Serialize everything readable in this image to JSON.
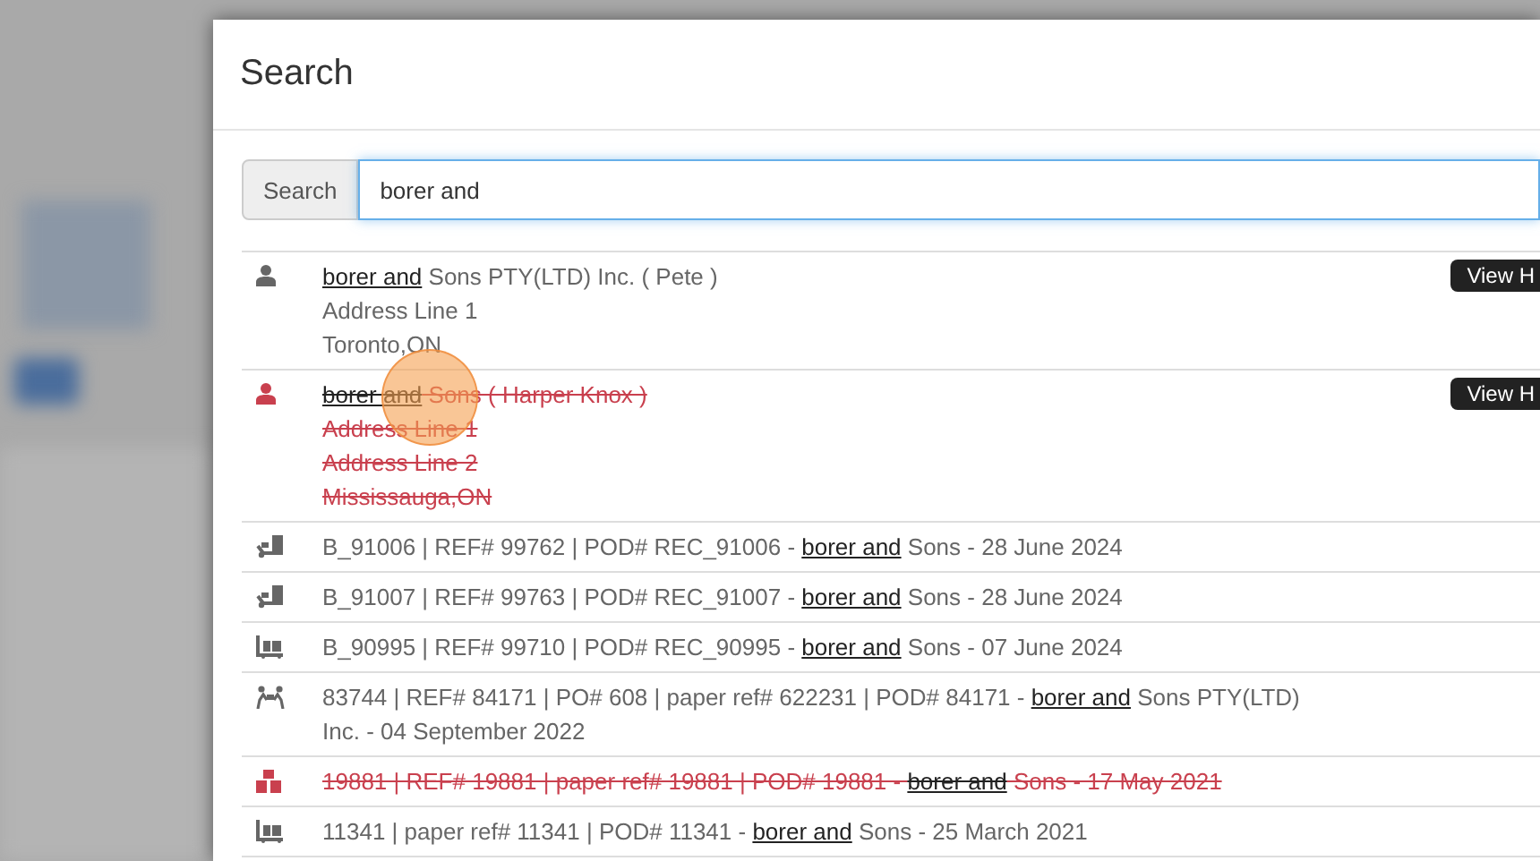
{
  "dialog": {
    "title": "Search",
    "search_button": "Search",
    "query": "borer and"
  },
  "results": [
    {
      "kind": "person",
      "deleted": false,
      "button": "View H",
      "lines": [
        {
          "match": "borer and",
          "after": " Sons PTY(LTD) Inc. ( Pete )"
        },
        {
          "before": "Address Line 1"
        },
        {
          "before": "Toronto,ON"
        }
      ]
    },
    {
      "kind": "person",
      "deleted": true,
      "button": "View H",
      "lines": [
        {
          "match": "borer and",
          "after": " Sons ( Harper Knox )"
        },
        {
          "before": "Address Line 1"
        },
        {
          "before": "Address Line 2"
        },
        {
          "before": "Mississauga,ON"
        }
      ]
    },
    {
      "kind": "dolly",
      "deleted": false,
      "lines": [
        {
          "before": "B_91006 | REF# 99762 | POD# REC_91006 - ",
          "match": "borer and",
          "after": " Sons - 28 June 2024"
        }
      ]
    },
    {
      "kind": "dolly",
      "deleted": false,
      "lines": [
        {
          "before": "B_91007 | REF# 99763 | POD# REC_91007 - ",
          "match": "borer and",
          "after": " Sons - 28 June 2024"
        }
      ]
    },
    {
      "kind": "cart",
      "deleted": false,
      "lines": [
        {
          "before": "B_90995 | REF# 99710 | POD# REC_90995 - ",
          "match": "borer and",
          "after": " Sons - 07 June 2024"
        }
      ]
    },
    {
      "kind": "people",
      "deleted": false,
      "lines": [
        {
          "before": "83744 | REF# 84171 | PO# 608 | paper ref# 622231 | POD# 84171 - ",
          "match": "borer and",
          "after": " Sons PTY(LTD) Inc. - 04 September 2022"
        }
      ]
    },
    {
      "kind": "boxes",
      "deleted": true,
      "lines": [
        {
          "before": "19881 | REF# 19881 | paper ref# 19881 | POD# 19881 - ",
          "match": "borer and",
          "after": " Sons - 17 May 2021"
        }
      ]
    },
    {
      "kind": "cart",
      "deleted": false,
      "lines": [
        {
          "before": "11341 | paper ref# 11341 | POD# 11341 - ",
          "match": "borer and",
          "after": " Sons - 25 March 2021"
        }
      ]
    }
  ]
}
